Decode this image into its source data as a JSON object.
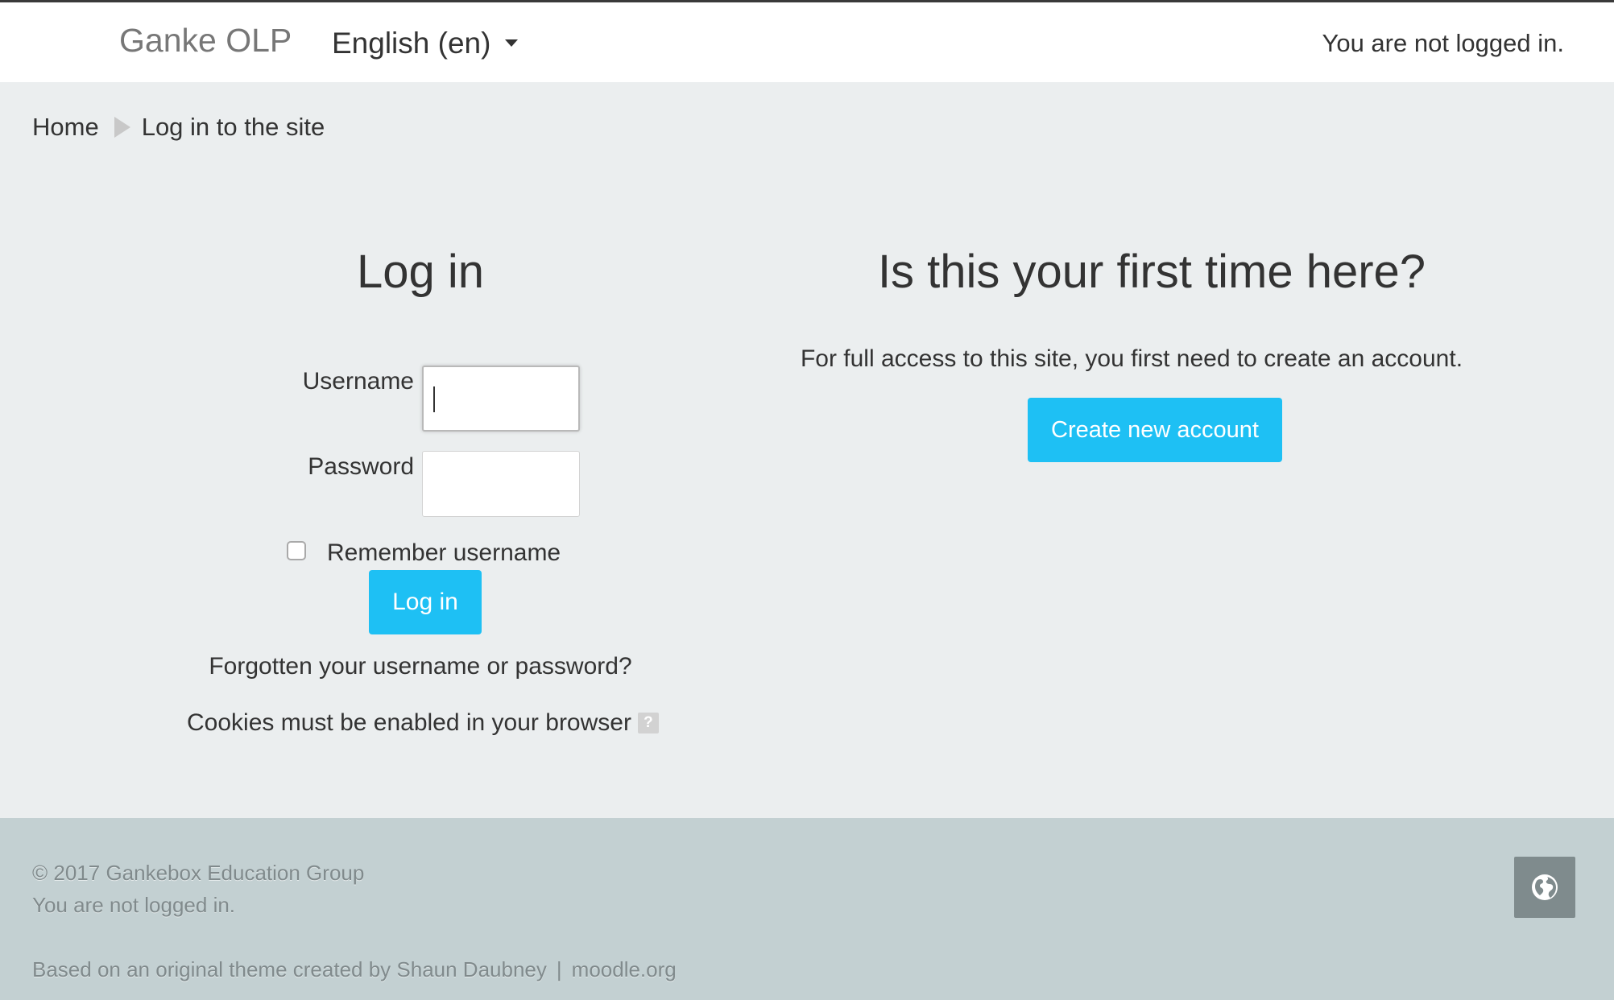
{
  "navbar": {
    "brand": "Ganke OLP",
    "language": "English (en)",
    "status": "You are not logged in."
  },
  "breadcrumb": {
    "home": "Home",
    "current": "Log in to the site"
  },
  "login": {
    "title": "Log in",
    "username_label": "Username",
    "username_value": "",
    "password_label": "Password",
    "password_value": "",
    "remember_label": "Remember username",
    "remember_checked": false,
    "submit_label": "Log in",
    "forgot_link": "Forgotten your username or password?",
    "cookies_note": "Cookies must be enabled in your browser",
    "help_icon_glyph": "?"
  },
  "signup": {
    "title": "Is this your first time here?",
    "text": "For full access to this site, you first need to create an account.",
    "button_label": "Create new account"
  },
  "footer": {
    "copyright": "© 2017 Gankebox Education Group",
    "status": "You are not logged in.",
    "credit_text": "Based on an original theme created by Shaun Daubney",
    "credit_separator": "|",
    "moodle_link": "moodle.org",
    "globe_icon": "globe-icon"
  },
  "colors": {
    "accent_button": "#1ec0f4",
    "page_background": "#ebeeef",
    "footer_background": "#c3d0d2",
    "navbar_background": "#ffffff"
  }
}
